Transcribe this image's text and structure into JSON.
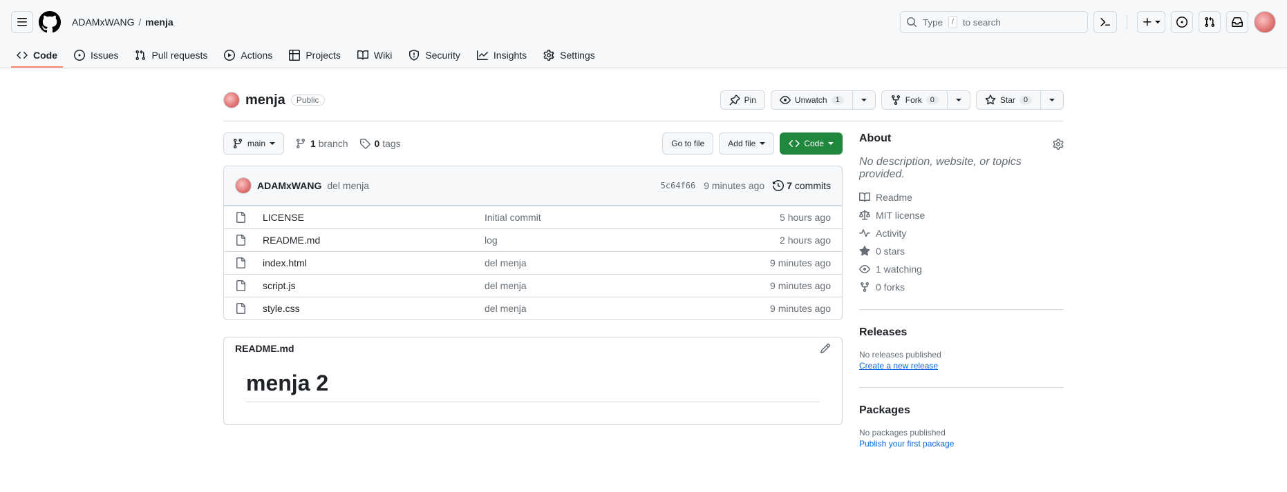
{
  "header": {
    "owner": "ADAMxWANG",
    "repo": "menja",
    "search_placeholder_pre": "Type",
    "search_key": "/",
    "search_placeholder_post": "to search"
  },
  "nav": {
    "code": "Code",
    "issues": "Issues",
    "pulls": "Pull requests",
    "actions": "Actions",
    "projects": "Projects",
    "wiki": "Wiki",
    "security": "Security",
    "insights": "Insights",
    "settings": "Settings"
  },
  "repo": {
    "name": "menja",
    "visibility": "Public",
    "pin": "Pin",
    "unwatch": "Unwatch",
    "watch_count": "1",
    "fork": "Fork",
    "fork_count": "0",
    "star": "Star",
    "star_count": "0"
  },
  "filebar": {
    "branch": "main",
    "branches_count": "1",
    "branches_label": "branch",
    "tags_count": "0",
    "tags_label": "tags",
    "goto": "Go to file",
    "addfile": "Add file",
    "code": "Code"
  },
  "latest_commit": {
    "author": "ADAMxWANG",
    "message": "del menja",
    "sha": "5c64f66",
    "time": "9 minutes ago",
    "commits_count": "7",
    "commits_label": "commits"
  },
  "files": [
    {
      "name": "LICENSE",
      "msg": "Initial commit",
      "time": "5 hours ago"
    },
    {
      "name": "README.md",
      "msg": "log",
      "time": "2 hours ago"
    },
    {
      "name": "index.html",
      "msg": "del menja",
      "time": "9 minutes ago"
    },
    {
      "name": "script.js",
      "msg": "del menja",
      "time": "9 minutes ago"
    },
    {
      "name": "style.css",
      "msg": "del menja",
      "time": "9 minutes ago"
    }
  ],
  "readme": {
    "filename": "README.md",
    "heading": "menja 2"
  },
  "about": {
    "title": "About",
    "description": "No description, website, or topics provided.",
    "readme": "Readme",
    "license": "MIT license",
    "activity": "Activity",
    "stars": "0 stars",
    "watching": "1 watching",
    "forks": "0 forks"
  },
  "releases": {
    "title": "Releases",
    "none": "No releases published",
    "create": "Create a new release"
  },
  "packages": {
    "title": "Packages",
    "none": "No packages published",
    "publish": "Publish your first package"
  }
}
